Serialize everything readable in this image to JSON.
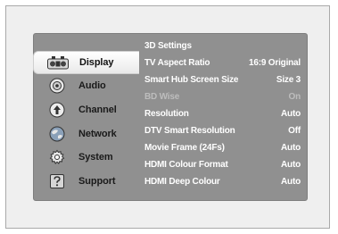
{
  "left_menu": {
    "items": [
      {
        "label": "Display",
        "icon": "display-icon",
        "selected": true
      },
      {
        "label": "Audio",
        "icon": "audio-icon",
        "selected": false
      },
      {
        "label": "Channel",
        "icon": "channel-icon",
        "selected": false
      },
      {
        "label": "Network",
        "icon": "network-icon",
        "selected": false
      },
      {
        "label": "System",
        "icon": "system-icon",
        "selected": false
      },
      {
        "label": "Support",
        "icon": "support-icon",
        "selected": false
      }
    ]
  },
  "display_settings": {
    "rows": [
      {
        "label": "3D Settings",
        "value": "",
        "enabled": true
      },
      {
        "label": "TV Aspect Ratio",
        "value": "16:9 Original",
        "enabled": true
      },
      {
        "label": "Smart Hub Screen Size",
        "value": "Size 3",
        "enabled": true
      },
      {
        "label": "BD Wise",
        "value": "On",
        "enabled": false
      },
      {
        "label": "Resolution",
        "value": "Auto",
        "enabled": true
      },
      {
        "label": "DTV Smart Resolution",
        "value": "Off",
        "enabled": true
      },
      {
        "label": "Movie Frame (24Fs)",
        "value": "Auto",
        "enabled": true
      },
      {
        "label": "HDMI Colour Format",
        "value": "Auto",
        "enabled": true
      },
      {
        "label": "HDMI Deep Colour",
        "value": "Auto",
        "enabled": true
      }
    ]
  },
  "colors": {
    "panel_bg": "#909090",
    "frame_bg": "#efefef",
    "selected_bg": "#ffffff",
    "text_enabled": "#ffffff",
    "text_disabled": "#bdbdbd"
  }
}
